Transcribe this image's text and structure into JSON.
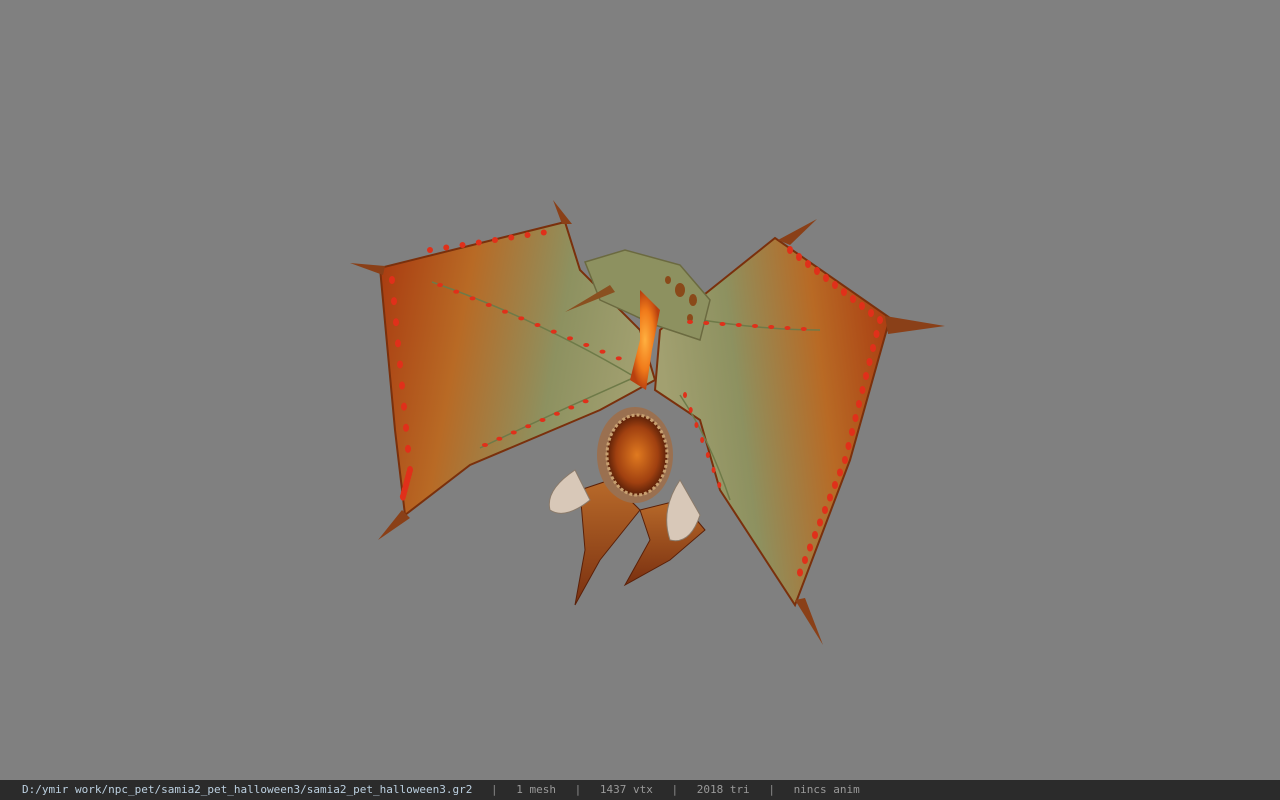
{
  "viewport": {
    "background_color": "#808080",
    "model_name": "samia2_pet_halloween3"
  },
  "statusbar": {
    "file_path": "D:/ymir work/npc_pet/samia2_pet_halloween3/samia2_pet_halloween3.gr2",
    "separator": "|",
    "mesh_count": "1 mesh",
    "vertex_count": "1437 vtx",
    "triangle_count": "2018 tri",
    "anim_status": "nincs anim"
  },
  "colors": {
    "wing_orange": "#c2481a",
    "wing_green": "#8d9160",
    "spots_red": "#e0301a",
    "spine_glow": "#f07a1a",
    "tusk": "#d8c8b8",
    "statusbar_bg": "#2b2b2b"
  }
}
